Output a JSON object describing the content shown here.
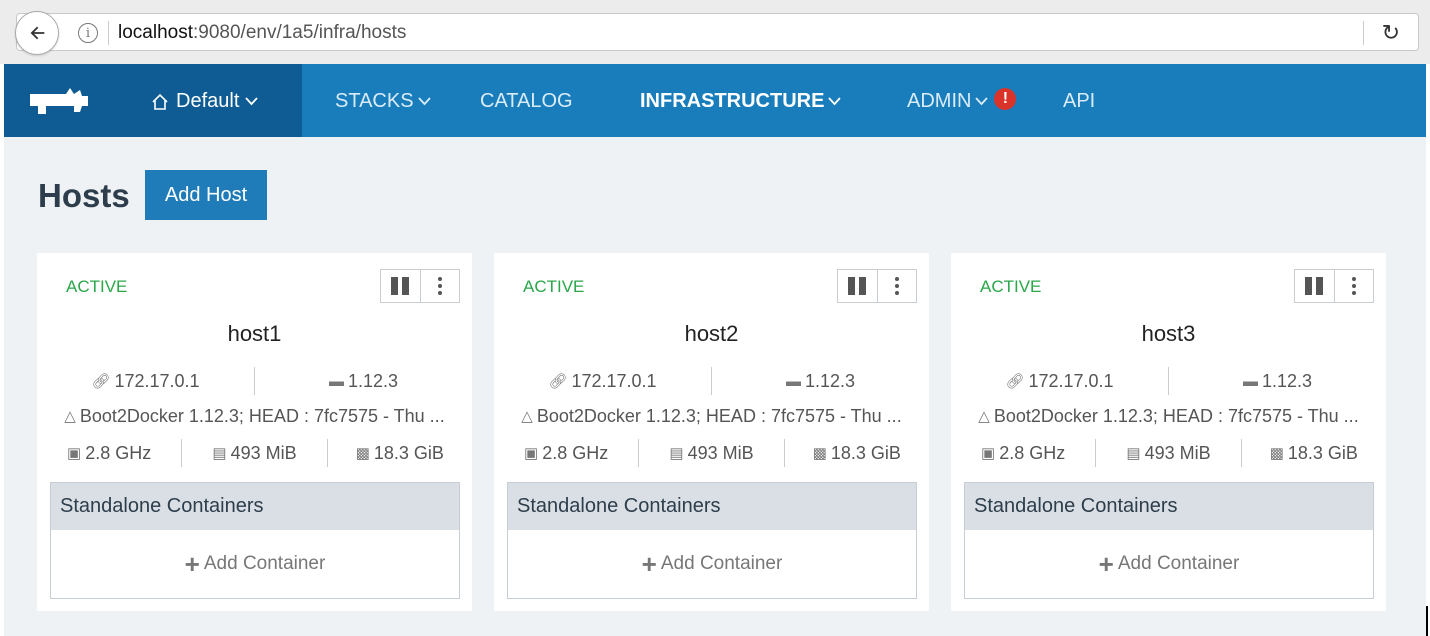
{
  "browser": {
    "url_host": "localhost",
    "url_rest": ":9080/env/1a5/infra/hosts"
  },
  "nav": {
    "environment": "Default",
    "items": [
      {
        "label": "STACKS",
        "dropdown": true,
        "active": false
      },
      {
        "label": "CATALOG",
        "dropdown": false,
        "active": false
      },
      {
        "label": "INFRASTRUCTURE",
        "dropdown": true,
        "active": true
      },
      {
        "label": "ADMIN",
        "dropdown": true,
        "active": false,
        "alert": "!"
      },
      {
        "label": "API",
        "dropdown": false,
        "active": false
      }
    ],
    "colors": {
      "bar": "#1a7dbb",
      "dark": "#0e5c93",
      "alert": "#d9332a"
    }
  },
  "page": {
    "title": "Hosts",
    "add_host_label": "Add Host"
  },
  "hosts": [
    {
      "status": "ACTIVE",
      "name": "host1",
      "ip": "172.17.0.1",
      "docker_version": "1.12.3",
      "os": "Boot2Docker 1.12.3; HEAD : 7fc7575 - Thu ...",
      "cpu": "2.8 GHz",
      "memory": "493 MiB",
      "storage": "18.3 GiB",
      "section_title": "Standalone Containers",
      "add_container_label": "Add Container"
    },
    {
      "status": "ACTIVE",
      "name": "host2",
      "ip": "172.17.0.1",
      "docker_version": "1.12.3",
      "os": "Boot2Docker 1.12.3; HEAD : 7fc7575 - Thu ...",
      "cpu": "2.8 GHz",
      "memory": "493 MiB",
      "storage": "18.3 GiB",
      "section_title": "Standalone Containers",
      "add_container_label": "Add Container"
    },
    {
      "status": "ACTIVE",
      "name": "host3",
      "ip": "172.17.0.1",
      "docker_version": "1.12.3",
      "os": "Boot2Docker 1.12.3; HEAD : 7fc7575 - Thu ...",
      "cpu": "2.8 GHz",
      "memory": "493 MiB",
      "storage": "18.3 GiB",
      "section_title": "Standalone Containers",
      "add_container_label": "Add Container"
    }
  ],
  "colors": {
    "status_active": "#2aa748",
    "button": "#1f7cb8",
    "page_bg": "#eef2f5"
  }
}
